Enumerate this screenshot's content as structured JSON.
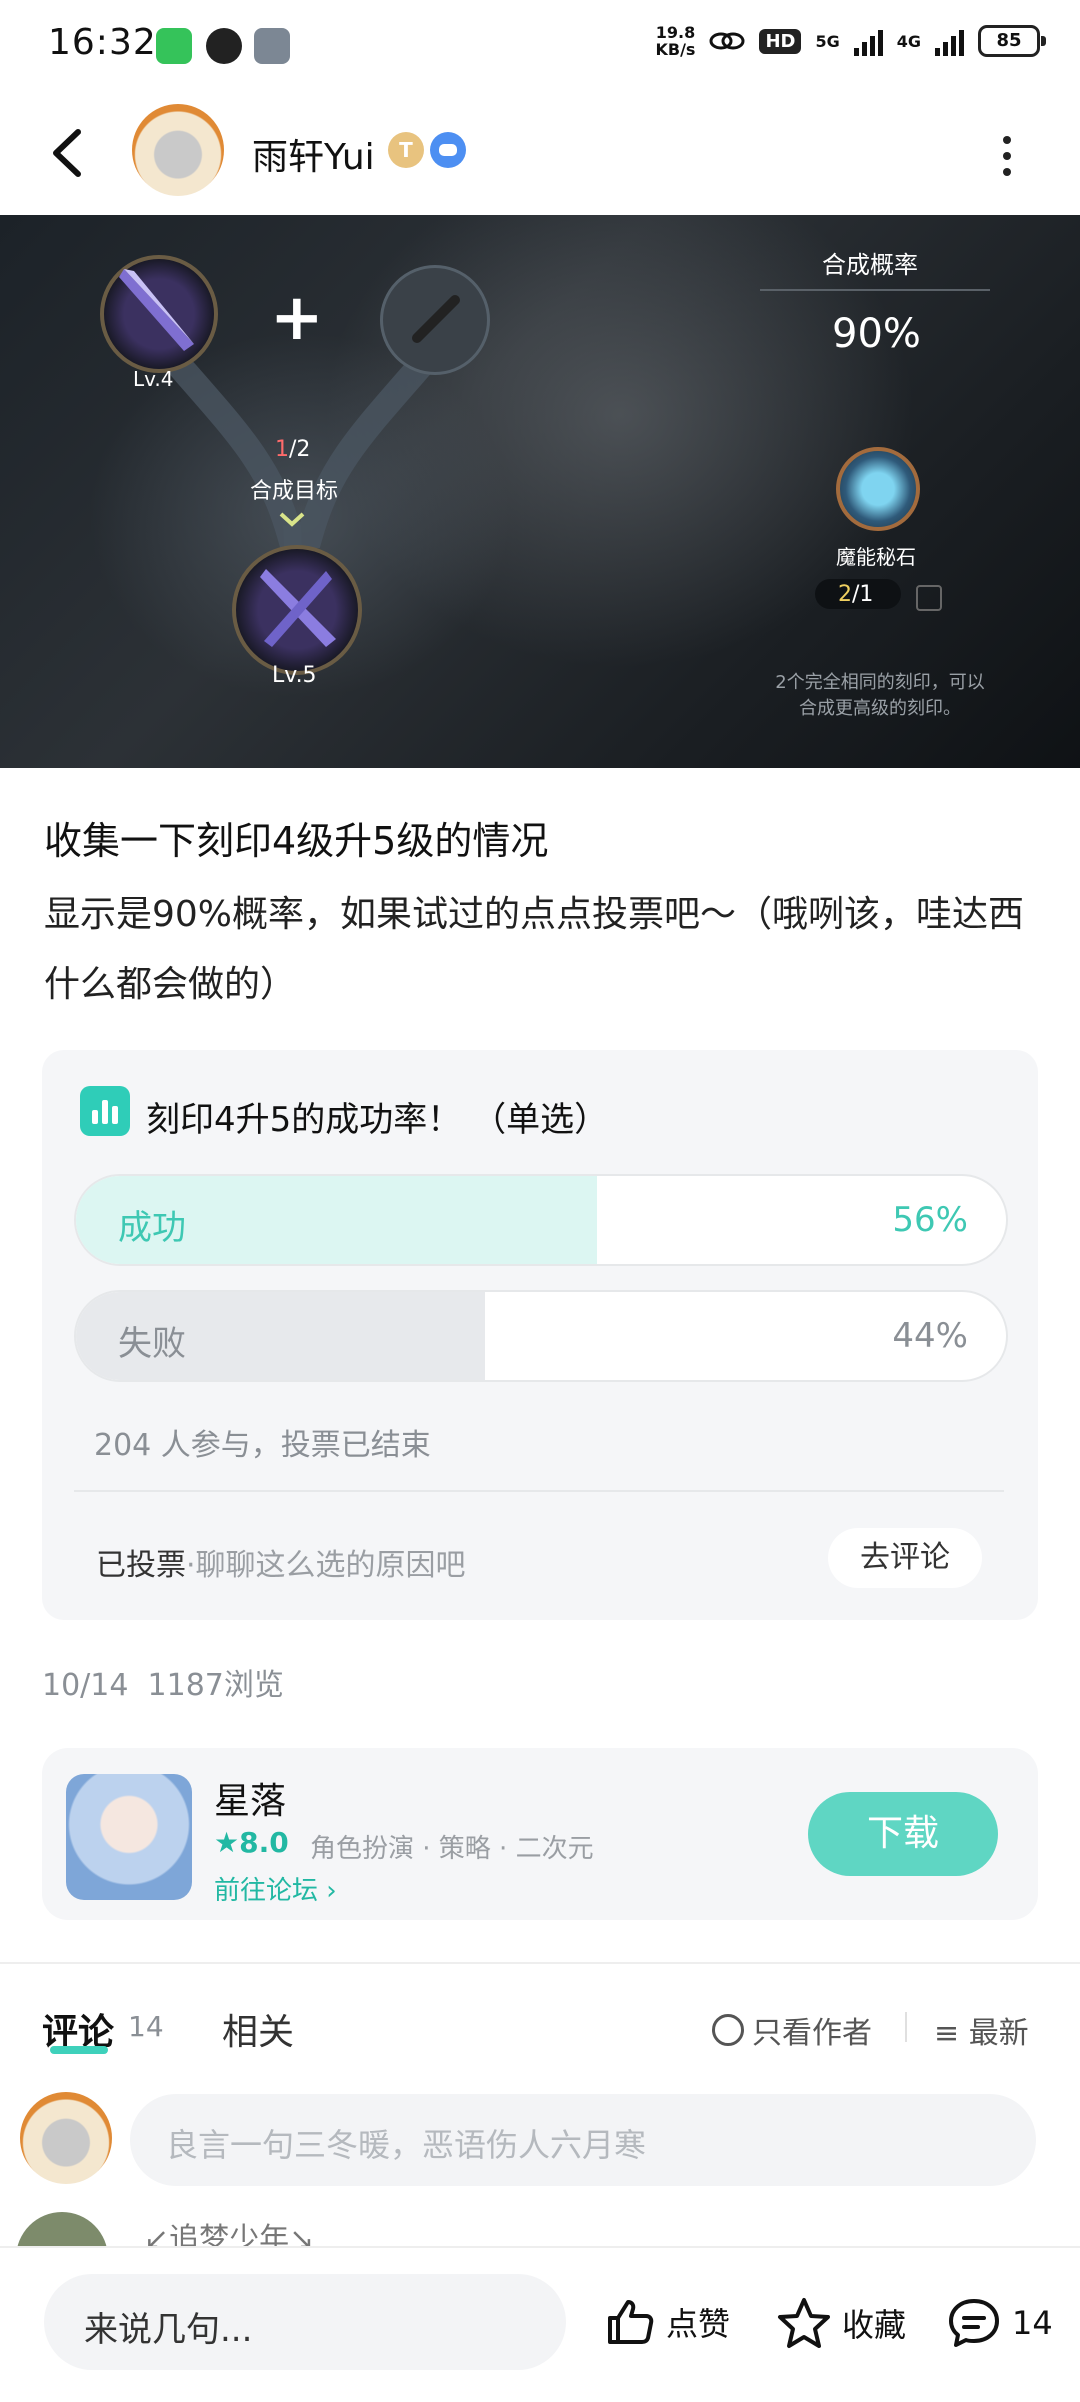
{
  "status_bar": {
    "time": "16:32",
    "speed_value": "19.8",
    "speed_unit": "KB/s",
    "hd_badge": "HD",
    "net_5g": "5G",
    "net_4g": "4G",
    "battery": "85"
  },
  "header": {
    "author_name": "雨轩Yui",
    "badge_t": "T"
  },
  "game_image": {
    "item_left_level": "Lv.4",
    "plus": "+",
    "progress_current": "1",
    "progress_total": "/2",
    "target_label": "合成目标",
    "result_level": "Lv.5",
    "rate_label": "合成概率",
    "rate_value": "90%",
    "stone_label": "魔能秘石",
    "stone_count": "2",
    "stone_total": "/1",
    "hint_line1": "2个完全相同的刻印，可以",
    "hint_line2": "合成更高级的刻印。"
  },
  "post": {
    "title": "收集一下刻印4级升5级的情况",
    "body": "显示是90%概率，如果试过的点点投票吧～（哦咧该，哇达西什么都会做的）",
    "date": "10/14",
    "views": "1187浏览"
  },
  "poll": {
    "title": "刻印4升5的成功率！ （单选）",
    "options": [
      {
        "label": "成功",
        "percent": "56%",
        "fraction": 0.56
      },
      {
        "label": "失败",
        "percent": "44%",
        "fraction": 0.44
      }
    ],
    "meta": "204 人参与，投票已结束",
    "voted": "已投票",
    "voted_hint": "·聊聊这么选的原因吧",
    "comment_button": "去评论"
  },
  "game_card": {
    "name": "星落",
    "score": "8.0",
    "tags": "角色扮演 · 策略 · 二次元",
    "forum_link": "前往论坛",
    "download": "下载"
  },
  "comments": {
    "tab_comment": "评论",
    "count": "14",
    "tab_related": "相关",
    "only_author": "只看作者",
    "latest": "最新",
    "input_placeholder": "良言一句三冬暖，恶语伤人六月寒",
    "peek_name": "↙追梦少年↘"
  },
  "bottom_bar": {
    "say_placeholder": "来说几句...",
    "like": "点赞",
    "favorite": "收藏",
    "comment_count": "14"
  },
  "colors": {
    "accent": "#3ed1bb",
    "poll_win_fill": "#dcf6f2",
    "poll_lose_fill": "#e7e9ec",
    "download_btn": "#5fd6c3"
  }
}
